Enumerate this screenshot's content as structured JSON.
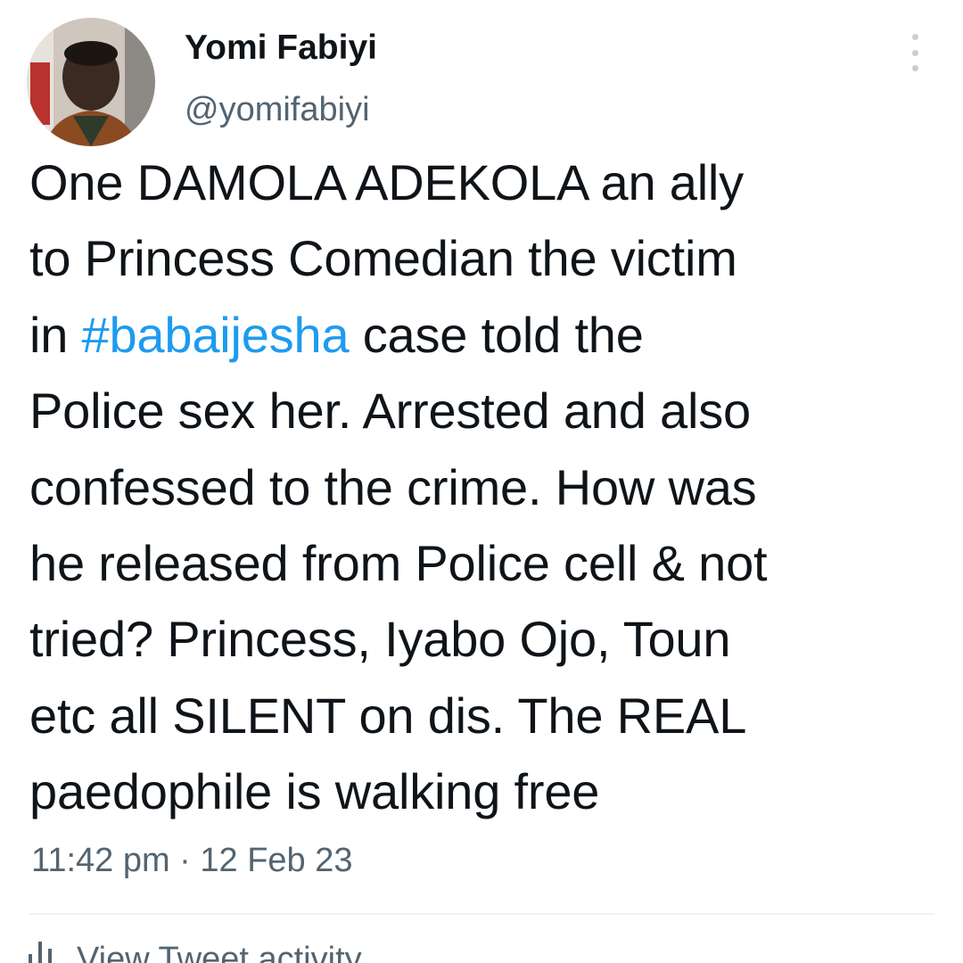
{
  "author": {
    "display_name": "Yomi Fabiyi",
    "handle": "@yomifabiyi",
    "avatar_icon": "profile-photo"
  },
  "menu": {
    "icon": "more-vertical-icon"
  },
  "tweet": {
    "lines": [
      {
        "text": "One DAMOLA ADEKOLA an ally"
      },
      {
        "text": "to Princess Comedian the victim"
      },
      {
        "pre": "in ",
        "hashtag": "#babaijesha",
        "post": " case told the"
      },
      {
        "text": "Police sex her. Arrested and also"
      },
      {
        "text": "confessed to the crime. How was"
      },
      {
        "text": "he released from Police cell & not"
      },
      {
        "text": "tried? Princess, Iyabo Ojo, Toun"
      },
      {
        "text": "etc all SILENT on dis. The REAL"
      },
      {
        "text": "paedophile is walking free"
      }
    ]
  },
  "meta": {
    "timestamp": "11:42 pm · 12 Feb 23"
  },
  "activity": {
    "label": "View Tweet activity",
    "icon": "bar-chart-icon"
  },
  "colors": {
    "text": "#0f1419",
    "secondary": "#536471",
    "link": "#1d9bf0",
    "divider": "#eff3f4"
  }
}
